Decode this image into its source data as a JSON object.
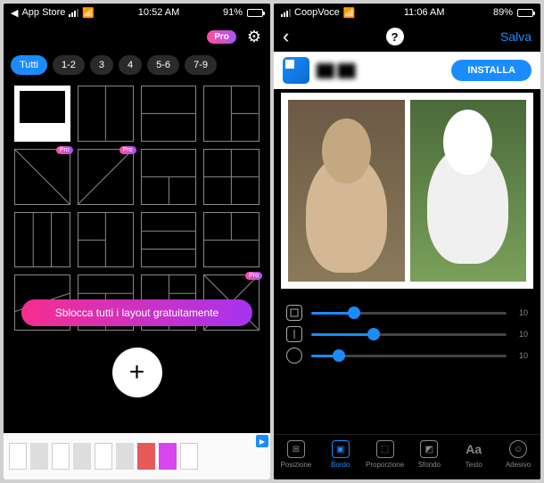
{
  "left": {
    "status": {
      "back_label": "App Store",
      "time": "10:52 AM",
      "battery_pct": "91%"
    },
    "nav": {
      "pro": "Pro"
    },
    "tabs": [
      "Tutti",
      "1-2",
      "3",
      "4",
      "5-6",
      "7-9"
    ],
    "unlock": "Sblocca tutti i layout gratuitamente",
    "fab": "+"
  },
  "right": {
    "status": {
      "carrier": "CoopVoce",
      "time": "11:06 AM",
      "battery_pct": "89%"
    },
    "nav": {
      "help": "?",
      "save": "Salva"
    },
    "install_btn": "INSTALLA",
    "sliders": [
      {
        "value": 10,
        "pct": 22
      },
      {
        "value": 10,
        "pct": 32
      },
      {
        "value": 10,
        "pct": 14
      }
    ],
    "tabs": [
      {
        "label": "Posizione"
      },
      {
        "label": "Bordo"
      },
      {
        "label": "Proporzione"
      },
      {
        "label": "Sfondo"
      },
      {
        "label": "Testo"
      },
      {
        "label": "Adesivo"
      }
    ]
  }
}
